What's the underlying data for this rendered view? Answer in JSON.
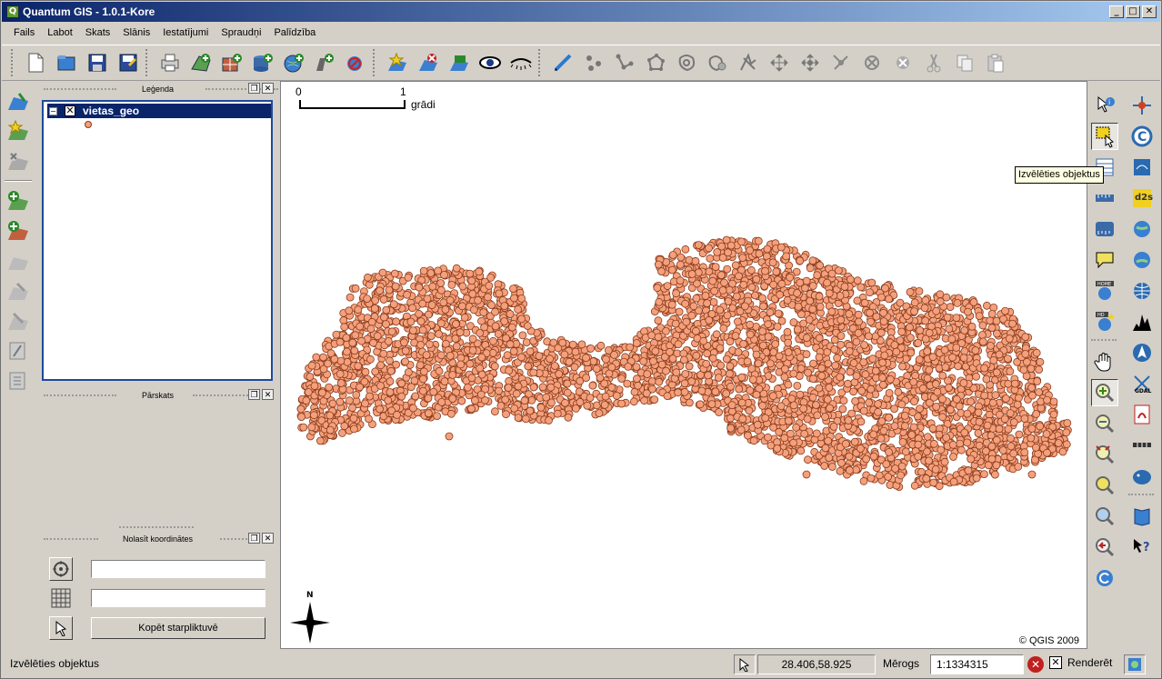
{
  "window": {
    "title": "Quantum GIS - 1.0.1-Kore",
    "buttons": {
      "minimize": "_",
      "maximize": "□",
      "close": "✕"
    }
  },
  "menu": [
    "Fails",
    "Labot",
    "Skats",
    "Slānis",
    "Iestatījumi",
    "Spraudņi",
    "Palīdzība"
  ],
  "toolbar_icons": [
    "new-project-icon",
    "open-project-icon",
    "save-project-icon",
    "save-as-icon",
    "print-icon",
    "add-vector-layer-icon",
    "add-raster-layer-icon",
    "add-postgis-layer-icon",
    "add-wms-layer-icon",
    "new-vector-layer-icon",
    "remove-layer-icon",
    "show-all-layers-icon",
    "hide-all-layers-icon",
    "show-layer-icon",
    "hide-layer-icon",
    "capture-line-icon",
    "capture-point-icon",
    "add-vertex-icon",
    "capture-polygon-icon",
    "add-ring-icon",
    "add-island-icon",
    "split-features-icon",
    "move-feature-icon",
    "move-vertex-icon",
    "delete-vertex-icon",
    "delete-selected-icon",
    "cut-features-icon",
    "copy-features-icon",
    "paste-features-icon"
  ],
  "legend_panel": {
    "title": "Leģenda",
    "layer_name": "vietas_geo",
    "layer_checked": "✕",
    "expand": "−"
  },
  "overview_panel": {
    "title": "Pārskats"
  },
  "coord_panel": {
    "title": "Nolasīt koordinātes",
    "field1": "",
    "field2": "",
    "copy_button": "Kopēt starpliktuvē"
  },
  "map": {
    "scalebar_left": "0",
    "scalebar_right": "1",
    "scalebar_unit": "grādi",
    "north": "N",
    "copyright": "© QGIS 2009",
    "point_color": "#f4a07c",
    "point_stroke": "#8a3a1a"
  },
  "tooltip": "Izvēlēties objektus",
  "plugin_labels": {
    "d2s": "d2s",
    "gdal": "GDAL",
    "home": "HOME",
    "hd": "HD"
  },
  "status": {
    "message": "Izvēlēties objektus",
    "coords": "28.406,58.925",
    "scale_label": "Mērogs",
    "scale_value": "1:1334315",
    "render_label": "Renderēt"
  }
}
